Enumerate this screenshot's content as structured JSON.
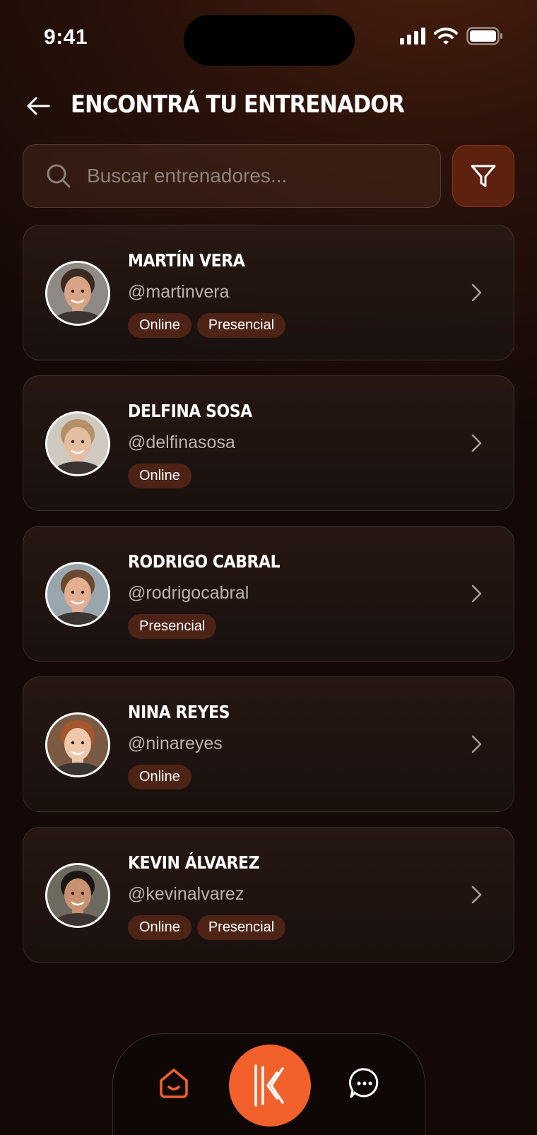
{
  "status_bar": {
    "time": "9:41"
  },
  "header": {
    "title": "ENCONTRÁ TU ENTRENADOR"
  },
  "search": {
    "placeholder": "Buscar entrenadores..."
  },
  "colors": {
    "accent": "#f2612b",
    "tag_background": "#4d2315",
    "background_dark": "#140907"
  },
  "trainers": [
    {
      "name": "MARTÍN VERA",
      "handle": "@martinvera",
      "tags": [
        "Online",
        "Presencial"
      ],
      "skin": "#d7a585",
      "hair": "#3a2a20",
      "bg": "#8f8a86"
    },
    {
      "name": "DELFINA SOSA",
      "handle": "@delfinasosa",
      "tags": [
        "Online"
      ],
      "skin": "#e5bda0",
      "hair": "#b49066",
      "bg": "#cfc9c2"
    },
    {
      "name": "RODRIGO CABRAL",
      "handle": "@rodrigocabral",
      "tags": [
        "Presencial"
      ],
      "skin": "#e3ae92",
      "hair": "#6b4a30",
      "bg": "#9aa6ae"
    },
    {
      "name": "NINA REYES",
      "handle": "@ninareyes",
      "tags": [
        "Online"
      ],
      "skin": "#efc7aa",
      "hair": "#a6562c",
      "bg": "#7a5a42"
    },
    {
      "name": "KEVIN ÁLVAREZ",
      "handle": "@kevinalvarez",
      "tags": [
        "Online",
        "Presencial"
      ],
      "skin": "#c89270",
      "hair": "#1c1612",
      "bg": "#6e6a60"
    }
  ],
  "nav": {
    "items": [
      "home-icon",
      "brand-icon",
      "chat-icon"
    ]
  }
}
